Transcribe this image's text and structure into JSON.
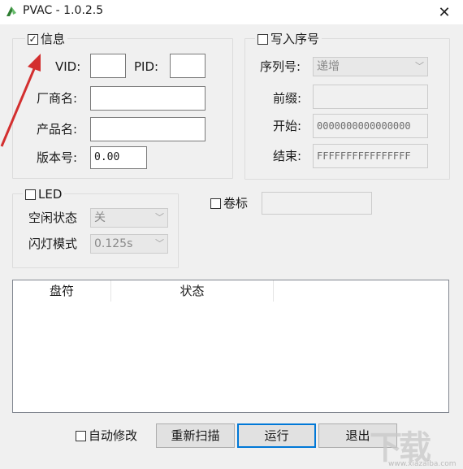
{
  "window": {
    "title": "PVAC - 1.0.2.5",
    "close_glyph": "✕"
  },
  "info_group": {
    "checkbox_label": "信息",
    "checked": true,
    "vid_label": "VID:",
    "pid_label": "PID:",
    "vendor_label": "厂商名:",
    "product_label": "产品名:",
    "version_label": "版本号:",
    "vid_value": "",
    "pid_value": "",
    "vendor_value": "",
    "product_value": "",
    "version_value": "0.00"
  },
  "serial_group": {
    "checkbox_label": "写入序号",
    "checked": false,
    "serial_label": "序列号:",
    "serial_mode": "递增",
    "prefix_label": "前缀:",
    "prefix_value": "",
    "start_label": "开始:",
    "start_value": "0000000000000000",
    "end_label": "结束:",
    "end_value": "FFFFFFFFFFFFFFFF"
  },
  "led_group": {
    "checkbox_label": "LED",
    "checked": false,
    "idle_label": "空闲状态",
    "idle_value": "关",
    "blink_label": "闪灯模式",
    "blink_value": "0.125s"
  },
  "volume": {
    "checkbox_label": "卷标",
    "checked": false,
    "value": ""
  },
  "list": {
    "columns": [
      "盘符",
      "状态"
    ]
  },
  "bottom": {
    "auto_modify_label": "自动修改",
    "rescan_label": "重新扫描",
    "run_label": "运行",
    "exit_label": "退出"
  },
  "watermark": {
    "text": "下载",
    "url": "www.xiazaiba.com"
  }
}
